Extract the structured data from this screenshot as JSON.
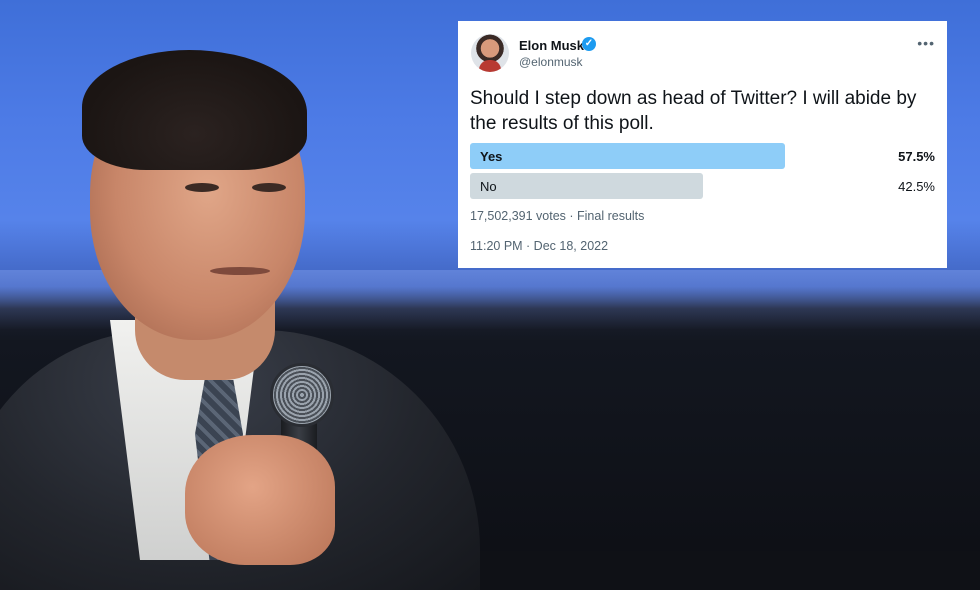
{
  "tweet": {
    "name": "Elon Musk",
    "handle": "@elonmusk",
    "more_icon": "more-horizontal-icon",
    "verified_icon": "verified-badge-icon",
    "text": "Should I step down as head of Twitter? I will abide by the results of this poll.",
    "poll": {
      "options": [
        {
          "label": "Yes",
          "percent_text": "57.5%",
          "share": 0.575,
          "color": "#8ecdf8",
          "leading": true
        },
        {
          "label": "No",
          "percent_text": "42.5%",
          "share": 0.425,
          "color": "#cfd9de",
          "leading": false
        }
      ],
      "votes_text": "17,502,391 votes · Final results"
    },
    "timestamp": "11:20 PM · Dec 18, 2022"
  },
  "colors": {
    "verified": "#1d9bf0",
    "text_primary": "#0f1419",
    "text_secondary": "#536471"
  }
}
